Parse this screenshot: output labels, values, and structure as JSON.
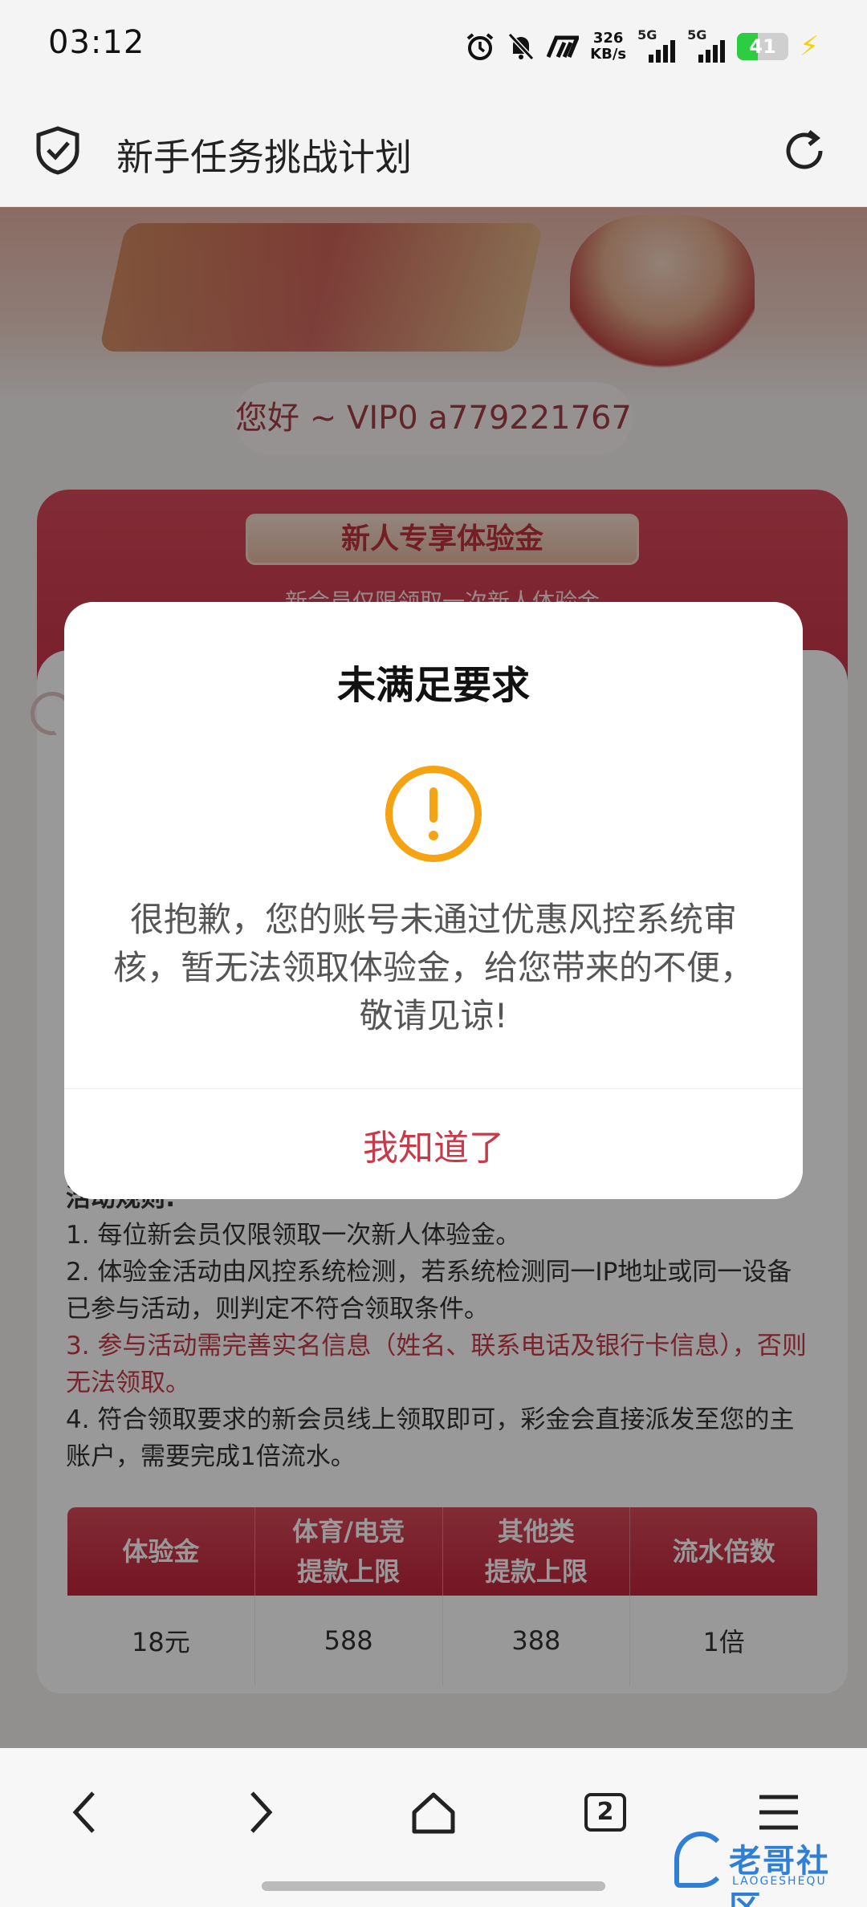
{
  "status_bar": {
    "time": "03:12",
    "net_speed_value": "326",
    "net_speed_unit": "KB/s",
    "sim1": "5G",
    "sim2": "5G",
    "battery_level": "41",
    "battery_fraction": 0.41,
    "icons": [
      "alarm-icon",
      "mute-icon",
      "custom-app-icon",
      "signal-icon",
      "battery-icon",
      "charging-icon"
    ]
  },
  "header": {
    "title": "新手任务挑战计划",
    "icons": [
      "shield-check-icon",
      "reload-icon"
    ]
  },
  "page": {
    "greeting": "您好 ~ VIP0 a779221767",
    "card_banner": "新人专享体验金",
    "card_sub": "新会员仅限领取一次新人体验金",
    "rules": {
      "heading": "活动规则:",
      "items": [
        "1. 每位新会员仅限领取一次新人体验金。",
        "2. 体验金活动由风控系统检测，若系统检测同一IP地址或同一设备已参与活动，则判定不符合领取条件。",
        "3. 参与活动需完善实名信息（姓名、联系电话及银行卡信息），否则无法领取。",
        "4. 符合领取要求的新会员线上领取即可，彩金会直接派发至您的主账户，需要完成1倍流水。"
      ]
    },
    "table": {
      "headers": [
        [
          "体验金"
        ],
        [
          "体育/电竞",
          "提款上限"
        ],
        [
          "其他类",
          "提款上限"
        ],
        [
          "流水倍数"
        ]
      ],
      "rows": [
        [
          "18元",
          "588",
          "388",
          "1倍"
        ]
      ]
    }
  },
  "modal": {
    "title": "未满足要求",
    "message": "很抱歉，您的账号未通过优惠风控系统审核，暂无法领取体验金，给您带来的不便，敬请见谅!",
    "ok_label": "我知道了",
    "icon": "warning-icon",
    "accent": "#f5a313",
    "button_color": "#c8394a"
  },
  "bottom_nav": {
    "tabs_count": "2",
    "icons": [
      "back-icon",
      "forward-icon",
      "home-icon",
      "tabs-icon",
      "menu-icon"
    ],
    "watermark_text": "老哥社区",
    "watermark_sub": "LAOGESHEQU"
  }
}
